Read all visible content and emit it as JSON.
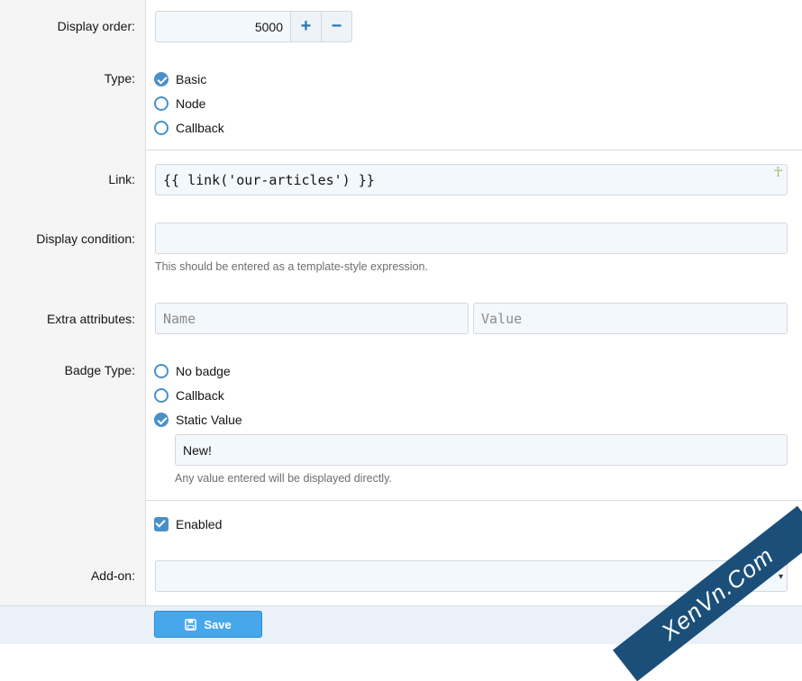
{
  "display_order": {
    "label": "Display order:",
    "value": "5000",
    "plus": "+",
    "minus": "−"
  },
  "type": {
    "label": "Type:",
    "options": [
      {
        "label": "Basic",
        "checked": true
      },
      {
        "label": "Node",
        "checked": false
      },
      {
        "label": "Callback",
        "checked": false
      }
    ]
  },
  "link": {
    "label": "Link:",
    "value": "{{ link('our-articles') }}"
  },
  "display_condition": {
    "label": "Display condition:",
    "value": "",
    "hint": "This should be entered as a template-style expression."
  },
  "extra_attributes": {
    "label": "Extra attributes:",
    "name_placeholder": "Name",
    "value_placeholder": "Value"
  },
  "badge_type": {
    "label": "Badge Type:",
    "options": [
      {
        "label": "No badge",
        "checked": false
      },
      {
        "label": "Callback",
        "checked": false
      },
      {
        "label": "Static Value",
        "checked": true
      }
    ],
    "static_value": "New!",
    "hint": "Any value entered will be displayed directly."
  },
  "enabled": {
    "label": "Enabled",
    "checked": true
  },
  "addon": {
    "label": "Add-on:",
    "value": ""
  },
  "footer": {
    "save_label": "Save"
  },
  "watermark": {
    "text": "XenVn.Com"
  },
  "colors": {
    "accent": "#47a7eb",
    "radio": "#4a90c8",
    "input_bg": "#f3f8fd"
  }
}
